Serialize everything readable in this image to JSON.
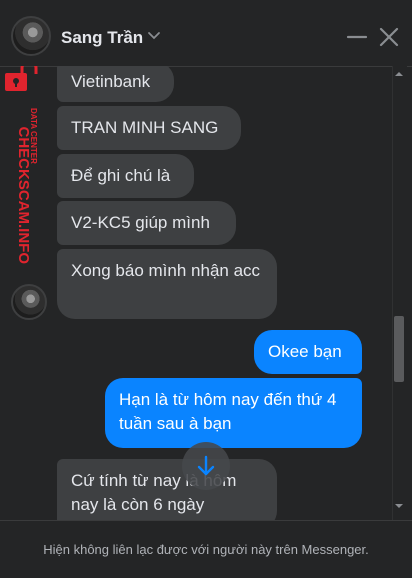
{
  "header": {
    "contact_name": "Sang Trần",
    "icons": [
      "chevron-down-icon",
      "minimize-icon",
      "close-icon"
    ]
  },
  "watermark": {
    "line1": "DATA CENTER",
    "line2": "CHECKSCAM.INFO",
    "color": "#e0242e"
  },
  "messages": [
    {
      "direction": "in",
      "text": "Vietinbank"
    },
    {
      "direction": "in",
      "text": "TRAN MINH SANG"
    },
    {
      "direction": "in",
      "text": "Để ghi chú là"
    },
    {
      "direction": "in",
      "text": "V2-KC5 giúp mình"
    },
    {
      "direction": "in",
      "text": "Xong báo mình nhận acc"
    },
    {
      "direction": "out",
      "text": "Okee bạn"
    },
    {
      "direction": "out",
      "text": "Hạn là từ hôm nay đến thứ 4 tuần sau à bạn"
    },
    {
      "direction": "in",
      "text": "Cứ tính từ nay là hôm nay là còn 6 ngày"
    }
  ],
  "colors": {
    "background": "#242526",
    "incoming_bubble": "#3e4042",
    "outgoing_bubble": "#0a84ff"
  },
  "footer": {
    "notice": "Hiện không liên lạc được với người này trên Messenger."
  }
}
